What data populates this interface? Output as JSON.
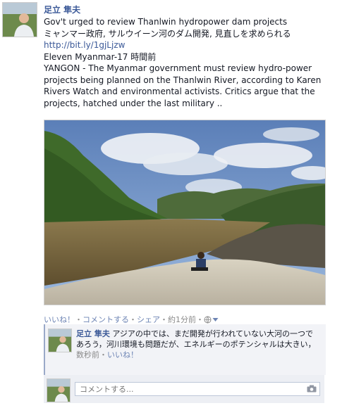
{
  "post": {
    "author": "足立 隼夫",
    "title_en": "Gov't urged to review Thanlwin hydropower dam projects",
    "title_jp": "ミャンマー政府, サルウイーン河のダム開発, 見直しを求められる",
    "link": "http://bit.ly/1gjLjzw",
    "source": "Eleven Myanmar-17 時間前",
    "excerpt": "YANGON - The Myanmar government must review hydro-power projects being planned on the Thanlwin River, according to Karen Rivers Watch and environmental activists. Critics argue that the projects, hatched under the last military .."
  },
  "actions": {
    "like": "いいね！",
    "comment": "コメントする",
    "share": "シェア",
    "time": "約1分前",
    "separator": "・"
  },
  "comment": {
    "author": "足立 隼夫",
    "text": "アジアの中では、まだ開発が行われていない大河の一つであろう，河川環境も問題だが、エネルギーのポテンシャルは大きい，",
    "time": "数秒前",
    "like": "いいね！"
  },
  "comment_input": {
    "placeholder": "コメントする..."
  },
  "icons": {
    "privacy": "globe-icon",
    "dropdown": "chevron-down-icon",
    "camera": "camera-icon"
  }
}
